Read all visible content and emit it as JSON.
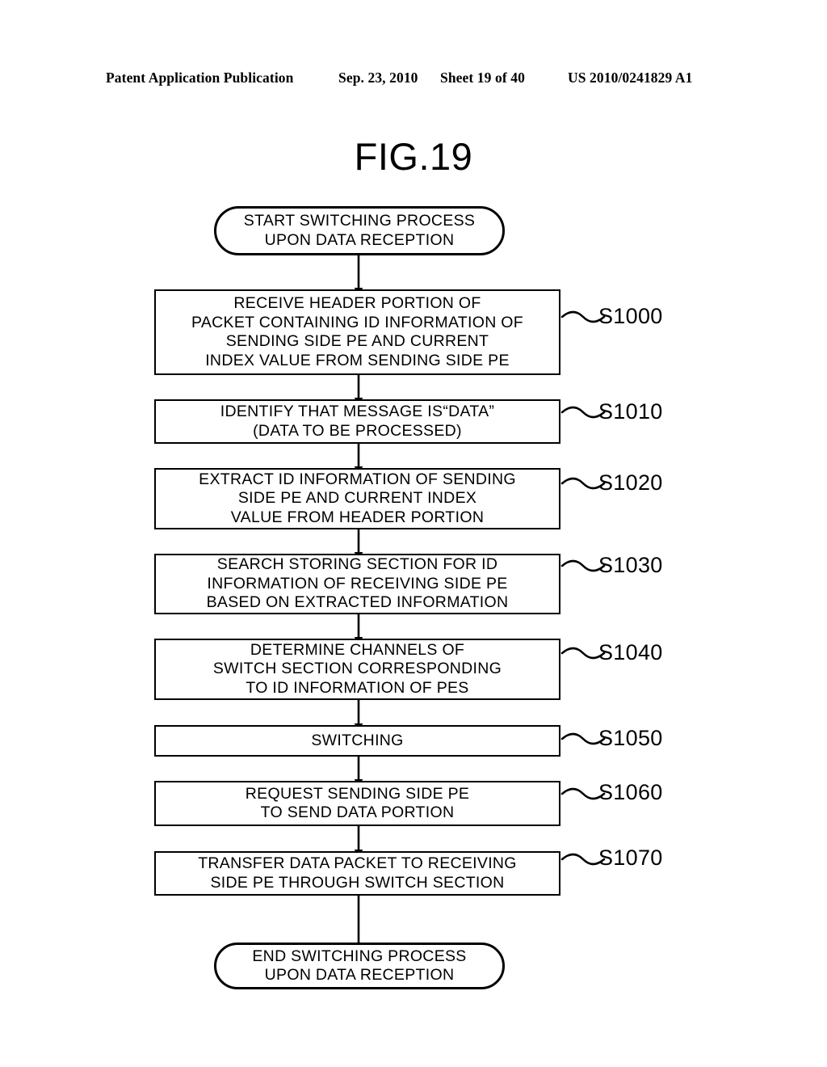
{
  "header": {
    "publication": "Patent Application Publication",
    "date": "Sep. 23, 2010",
    "sheet": "Sheet 19 of 40",
    "patent_number": "US 2010/0241829 A1"
  },
  "figure": {
    "title": "FIG.19"
  },
  "flowchart": {
    "start": {
      "line1": "START SWITCHING PROCESS",
      "line2": "UPON DATA RECEPTION"
    },
    "end": {
      "line1": "END SWITCHING PROCESS",
      "line2": "UPON DATA RECEPTION"
    },
    "steps": [
      {
        "id": "S1000",
        "lines": [
          "RECEIVE HEADER PORTION OF",
          "PACKET CONTAINING ID INFORMATION OF",
          "SENDING SIDE PE AND CURRENT",
          "INDEX VALUE FROM SENDING SIDE PE"
        ]
      },
      {
        "id": "S1010",
        "lines": [
          "IDENTIFY THAT MESSAGE IS“DATA”",
          "(DATA TO BE PROCESSED)"
        ]
      },
      {
        "id": "S1020",
        "lines": [
          "EXTRACT ID INFORMATION OF SENDING",
          "SIDE PE AND CURRENT INDEX",
          "VALUE FROM HEADER PORTION"
        ]
      },
      {
        "id": "S1030",
        "lines": [
          "SEARCH STORING SECTION FOR ID",
          "INFORMATION OF RECEIVING SIDE PE",
          "BASED ON EXTRACTED INFORMATION"
        ]
      },
      {
        "id": "S1040",
        "lines": [
          "DETERMINE CHANNELS OF",
          "SWITCH SECTION CORRESPONDING",
          "TO ID INFORMATION OF PES"
        ]
      },
      {
        "id": "S1050",
        "lines": [
          "SWITCHING"
        ]
      },
      {
        "id": "S1060",
        "lines": [
          "REQUEST SENDING SIDE PE",
          "TO SEND DATA PORTION"
        ]
      },
      {
        "id": "S1070",
        "lines": [
          "TRANSFER DATA PACKET TO RECEIVING",
          "SIDE PE THROUGH SWITCH SECTION"
        ]
      }
    ]
  },
  "colors": {
    "ink": "#000000",
    "paper": "#ffffff"
  }
}
